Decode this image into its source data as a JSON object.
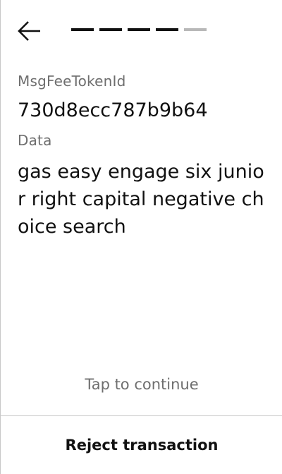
{
  "nav": {
    "back_icon": "arrow-left-icon",
    "progress": {
      "total_steps": 5,
      "completed_steps": 4
    }
  },
  "fields": {
    "fee_token": {
      "label": "MsgFeeTokenId",
      "value": "730d8ecc787b9b64"
    },
    "data": {
      "label": "Data",
      "value": "gas easy engage six junior right capital negative choice search"
    }
  },
  "footer": {
    "hint": "Tap to continue",
    "reject_label": "Reject transaction"
  },
  "colors": {
    "text": "#111111",
    "muted": "#6e6e6e",
    "progress_done": "#111111",
    "progress_pending": "#b8b8b8",
    "divider": "#c8c8c8"
  }
}
